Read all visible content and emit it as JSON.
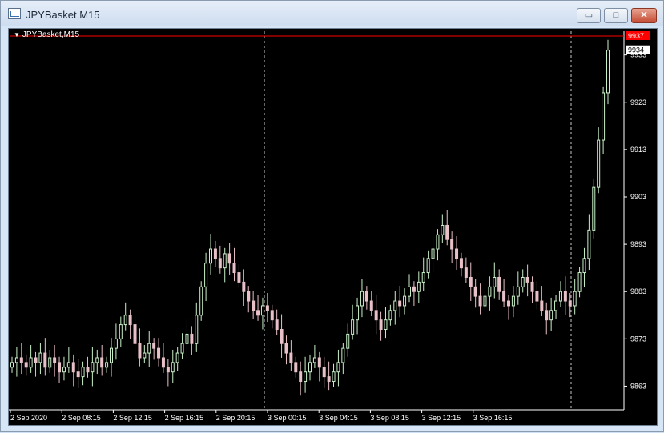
{
  "window": {
    "title": "JPYBasket,M15"
  },
  "window_controls": {
    "minimize": "▭",
    "maximize": "□",
    "close": "✕"
  },
  "chart": {
    "label_arrow": "▼",
    "label": "JPYBasket,M15"
  },
  "chart_data": {
    "type": "candlestick",
    "symbol": "JPYBasket",
    "timeframe": "M15",
    "ylim": [
      9858,
      9937
    ],
    "y_ticks": [
      9863,
      9873,
      9883,
      9893,
      9903,
      9913,
      9923,
      9933
    ],
    "x_ticks": [
      "2 Sep 2020",
      "2 Sep 08:15",
      "2 Sep 12:15",
      "2 Sep 16:15",
      "2 Sep 20:15",
      "3 Sep 00:15",
      "3 Sep 04:15",
      "3 Sep 08:15",
      "3 Sep 12:15",
      "3 Sep 16:15"
    ],
    "price_lines": [
      {
        "label": "9937",
        "value": 9937,
        "color": "#ff0000"
      },
      {
        "label": "9934",
        "value": 9934,
        "color": "#ffffff"
      }
    ],
    "period_separators": [
      "3 Sep 00:15",
      "4 Sep 00:15"
    ],
    "bull_color": "#c8f0c8",
    "bear_color": "#e8c0c8",
    "close_series": [
      9868,
      9869,
      9868,
      9867,
      9869,
      9868,
      9870,
      9867,
      9869,
      9868,
      9866,
      9867,
      9868,
      9866,
      9865,
      9867,
      9866,
      9868,
      9869,
      9867,
      9868,
      9871,
      9873,
      9876,
      9878,
      9876,
      9872,
      9869,
      9870,
      9872,
      9871,
      9869,
      9867,
      9866,
      9868,
      9870,
      9872,
      9874,
      9872,
      9878,
      9884,
      9889,
      9892,
      9890,
      9888,
      9891,
      9889,
      9887,
      9885,
      9883,
      9881,
      9879,
      9878,
      9880,
      9879,
      9877,
      9875,
      9872,
      9870,
      9868,
      9866,
      9864,
      9866,
      9868,
      9869,
      9867,
      9865,
      9864,
      9866,
      9868,
      9871,
      9874,
      9877,
      9880,
      9883,
      9881,
      9879,
      9877,
      9875,
      9877,
      9879,
      9881,
      9880,
      9882,
      9884,
      9883,
      9885,
      9887,
      9890,
      9892,
      9895,
      9897,
      9894,
      9892,
      9890,
      9888,
      9886,
      9884,
      9882,
      9880,
      9882,
      9884,
      9886,
      9883,
      9881,
      9880,
      9882,
      9884,
      9886,
      9885,
      9883,
      9881,
      9879,
      9877,
      9879,
      9881,
      9883,
      9881,
      9880,
      9883,
      9887,
      9890,
      9896,
      9905,
      9915,
      9925,
      9934
    ]
  }
}
